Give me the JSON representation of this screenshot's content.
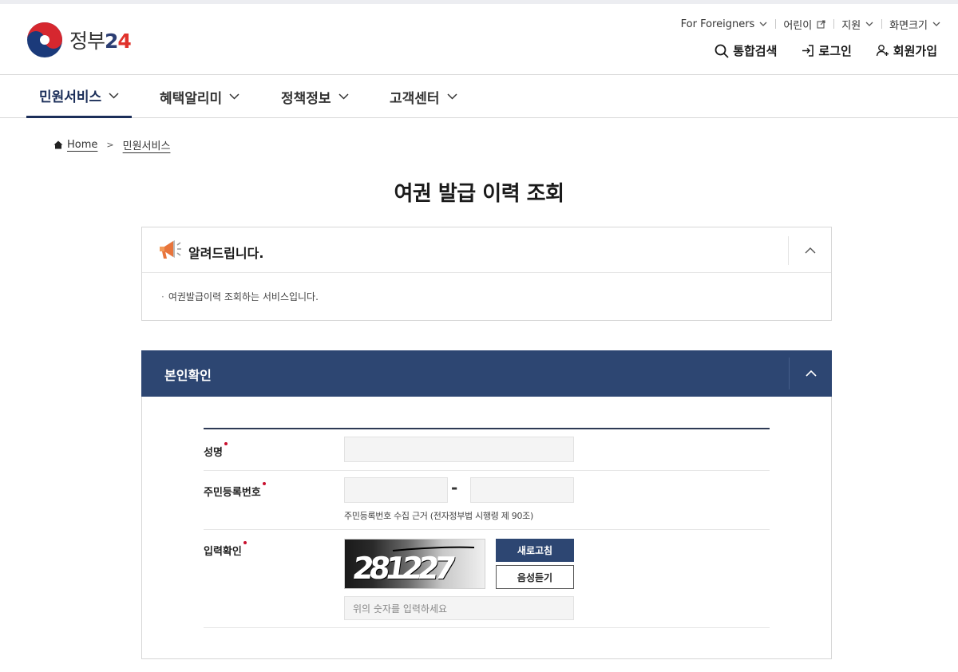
{
  "header": {
    "logo_text": "정부",
    "logo_num": "2",
    "logo_num4": "4",
    "util": [
      {
        "label": "For Foreigners",
        "icon": "chevron-down-icon"
      },
      {
        "label": "어린이",
        "icon": "external-link-icon"
      },
      {
        "label": "지원",
        "icon": "chevron-down-icon"
      },
      {
        "label": "화면크기",
        "icon": "chevron-down-icon"
      }
    ],
    "actions": [
      {
        "label": "통합검색",
        "icon": "search-icon"
      },
      {
        "label": "로그인",
        "icon": "login-icon"
      },
      {
        "label": "회원가입",
        "icon": "user-add-icon"
      }
    ]
  },
  "gnb": [
    {
      "label": "민원서비스",
      "active": true
    },
    {
      "label": "혜택알리미"
    },
    {
      "label": "정책정보"
    },
    {
      "label": "고객센터"
    }
  ],
  "breadcrumb": {
    "home": "Home",
    "current": "민원서비스"
  },
  "page_title": "여권 발급 이력 조회",
  "notice": {
    "title": "알려드립니다.",
    "body": "여권발급이력 조회하는 서비스입니다."
  },
  "panel": {
    "title": "본인확인",
    "fields": {
      "name_label": "성명",
      "rrn_label": "주민등록번호",
      "rrn_separator": "-",
      "rrn_hint": "주민등록번호 수집 근거 (전자정부법 시행령 제 90조)",
      "captcha_label": "입력확인",
      "captcha_digits": "281227",
      "refresh_label": "새로고침",
      "audio_label": "음성듣기",
      "captcha_placeholder": "위의 숫자를 입력하세요"
    }
  },
  "colors": {
    "primary": "#2d4672",
    "nav_active": "#1b2e59",
    "required": "#c8102e"
  }
}
